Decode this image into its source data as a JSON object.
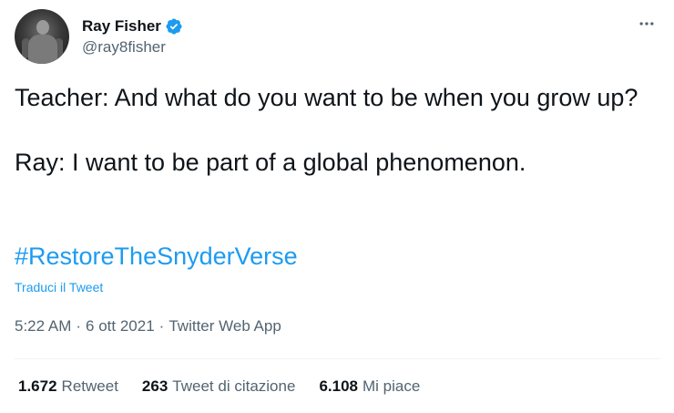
{
  "author": {
    "name": "Ray Fisher",
    "handle": "@ray8fisher",
    "verified": true,
    "verified_icon": "verified-badge-icon",
    "avatar_icon": "avatar"
  },
  "more_icon": "more-horizontal-icon",
  "tweet": {
    "line1": "Teacher: And what do you want to be when you grow up?",
    "line2": "Ray: I want to be part of a global phenomenon.",
    "hashtag": "#RestoreTheSnyderVerse",
    "translate_label": "Traduci il Tweet"
  },
  "meta": {
    "time": "5:22 AM",
    "separator": "·",
    "date": "6 ott 2021",
    "source": "Twitter Web App"
  },
  "stats": [
    {
      "count": "1.672",
      "label": "Retweet"
    },
    {
      "count": "263",
      "label": "Tweet di citazione"
    },
    {
      "count": "6.108",
      "label": "Mi piace"
    }
  ],
  "colors": {
    "accent": "#1d9bf0",
    "text": "#0f1419",
    "secondary": "#536471"
  }
}
